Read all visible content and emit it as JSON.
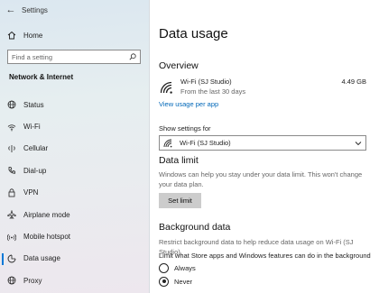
{
  "window": {
    "title": "Settings"
  },
  "sidebar": {
    "home_label": "Home",
    "search_placeholder": "Find a setting",
    "section_title": "Network & Internet",
    "items": [
      {
        "label": "Status",
        "icon": "globe-icon"
      },
      {
        "label": "Wi-Fi",
        "icon": "wifi-icon"
      },
      {
        "label": "Cellular",
        "icon": "cellular-icon"
      },
      {
        "label": "Dial-up",
        "icon": "phone-icon"
      },
      {
        "label": "VPN",
        "icon": "vpn-icon"
      },
      {
        "label": "Airplane mode",
        "icon": "airplane-icon"
      },
      {
        "label": "Mobile hotspot",
        "icon": "hotspot-icon"
      },
      {
        "label": "Data usage",
        "icon": "data-usage-icon",
        "active": true
      },
      {
        "label": "Proxy",
        "icon": "globe-icon"
      }
    ]
  },
  "main": {
    "title": "Data usage",
    "overview": {
      "header": "Overview",
      "network_name": "Wi-Fi (SJ Studio)",
      "period": "From the last 30 days",
      "amount": "4.49 GB",
      "link": "View usage per app"
    },
    "show_settings": {
      "label": "Show settings for",
      "selected": "Wi-Fi (SJ Studio)"
    },
    "data_limit": {
      "header": "Data limit",
      "description": "Windows can help you stay under your data limit. This won't change your data plan.",
      "button": "Set limit"
    },
    "background_data": {
      "header": "Background data",
      "description": "Restrict background data to help reduce data usage on Wi-Fi (SJ Studio)",
      "question": "Limit what Store apps and Windows features can do in the background",
      "options": [
        {
          "label": "Always",
          "checked": false
        },
        {
          "label": "Never",
          "checked": true
        }
      ]
    }
  },
  "colors": {
    "accent": "#0078d7",
    "link": "#0067b8"
  }
}
